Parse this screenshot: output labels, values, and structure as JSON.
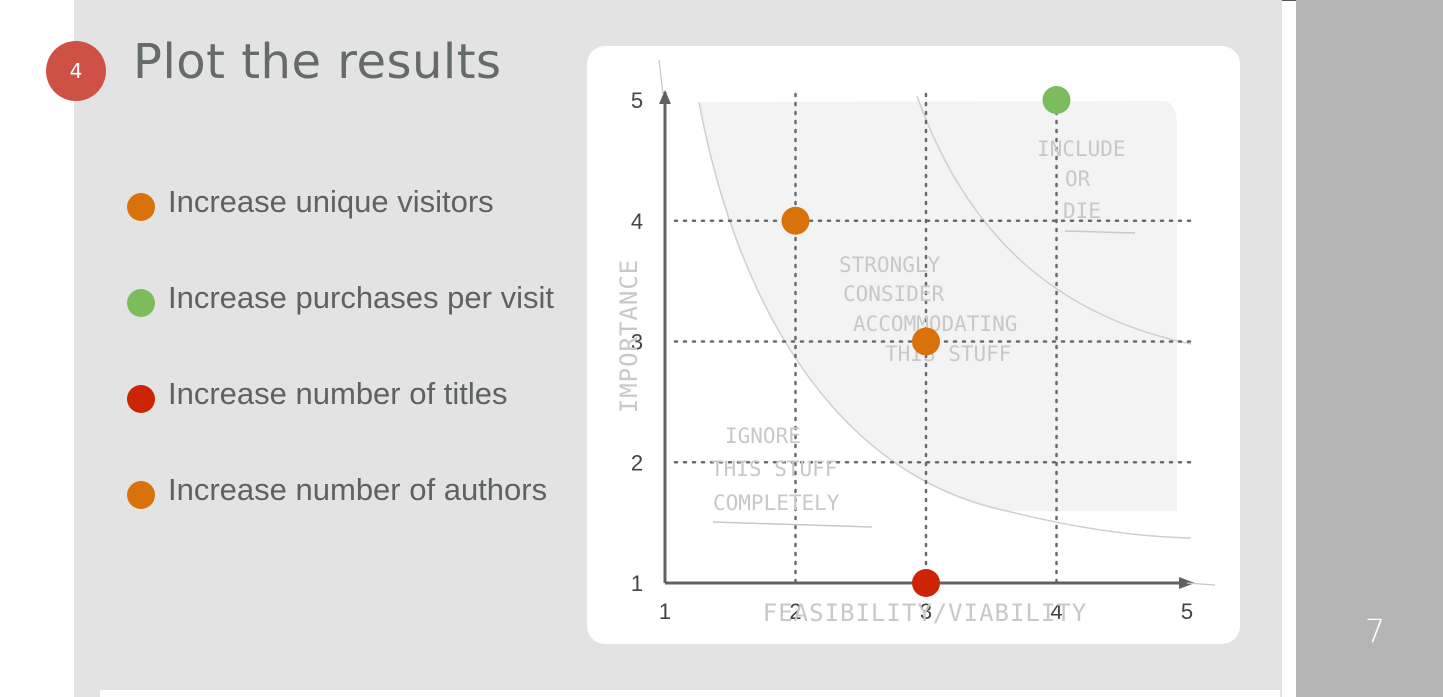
{
  "slide": {
    "step_number": "4",
    "title": "Plot the results",
    "page_number": "7"
  },
  "legend": [
    {
      "label": "Increase unique visitors",
      "color": "#d9720b"
    },
    {
      "label": "Increase purchases per visit",
      "color": "#7cbc5c"
    },
    {
      "label": "Increase number of titles",
      "color": "#cc2404"
    },
    {
      "label": "Increase number of authors",
      "color": "#d9720b"
    }
  ],
  "colors": {
    "accent": "#cf5146",
    "slide_background": "#e3e3e3",
    "side_panel": "#b5b5b5",
    "axis": "#5f6262",
    "sketch": "#c8c8c8"
  },
  "chart_data": {
    "type": "scatter",
    "xlabel": "FEASIBILITY/VIABILITY",
    "ylabel": "IMPORTANCE",
    "xlim": [
      1,
      5
    ],
    "ylim": [
      1,
      5
    ],
    "x_ticks": [
      1,
      2,
      3,
      4,
      5
    ],
    "y_ticks": [
      1,
      2,
      3,
      4,
      5
    ],
    "grid_lines": {
      "x": [
        2,
        3,
        4
      ],
      "y": [
        2,
        3,
        4
      ]
    },
    "grid_style": "dotted",
    "points": [
      {
        "series": "Increase unique visitors",
        "x": 2,
        "y": 4,
        "color": "#d9720b"
      },
      {
        "series": "Increase purchases per visit",
        "x": 4,
        "y": 5,
        "color": "#7cbc5c"
      },
      {
        "series": "Increase number of titles",
        "x": 3,
        "y": 1,
        "color": "#cc2404"
      },
      {
        "series": "Increase number of authors",
        "x": 3,
        "y": 3,
        "color": "#d9720b"
      }
    ],
    "annotations": [
      {
        "lines": [
          "INCLUDE",
          "OR",
          "DIE"
        ],
        "zone": "top-right"
      },
      {
        "lines": [
          "STRONGLY",
          "CONSIDER",
          "ACCOMMODATING",
          "THIS STUFF"
        ],
        "zone": "center"
      },
      {
        "lines": [
          "IGNORE",
          "THIS STUFF",
          "COMPLETELY"
        ],
        "zone": "bottom-left"
      }
    ]
  }
}
